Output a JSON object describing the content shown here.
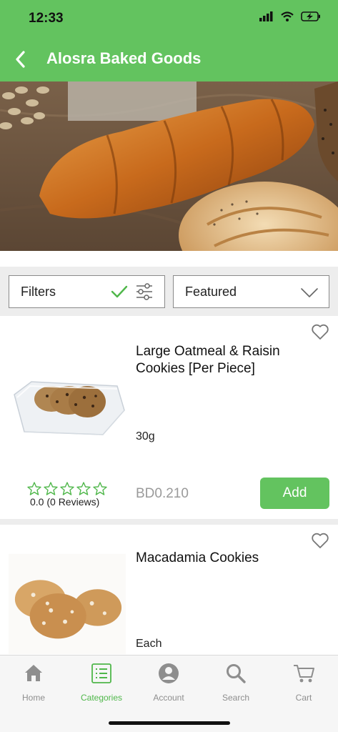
{
  "status": {
    "time": "12:33"
  },
  "header": {
    "title": "Alosra Baked Goods"
  },
  "toolbar": {
    "filters_label": "Filters",
    "sort_label": "Featured"
  },
  "products": [
    {
      "name": "Large Oatmeal & Raisin Cookies [Per Piece]",
      "unit": "30g",
      "rating_text": "0.0 (0 Reviews)",
      "rating": 0,
      "price": "BD0.210",
      "add_label": "Add"
    },
    {
      "name": "Macadamia Cookies",
      "unit": "Each"
    }
  ],
  "tabs": [
    {
      "label": "Home",
      "icon": "home-icon"
    },
    {
      "label": "Categories",
      "icon": "list-icon"
    },
    {
      "label": "Account",
      "icon": "account-icon"
    },
    {
      "label": "Search",
      "icon": "search-icon"
    },
    {
      "label": "Cart",
      "icon": "cart-icon"
    }
  ],
  "colors": {
    "brand_green": "#63c35f",
    "active_tab": "#4fb74a",
    "price_grey": "#9a9a9a"
  }
}
